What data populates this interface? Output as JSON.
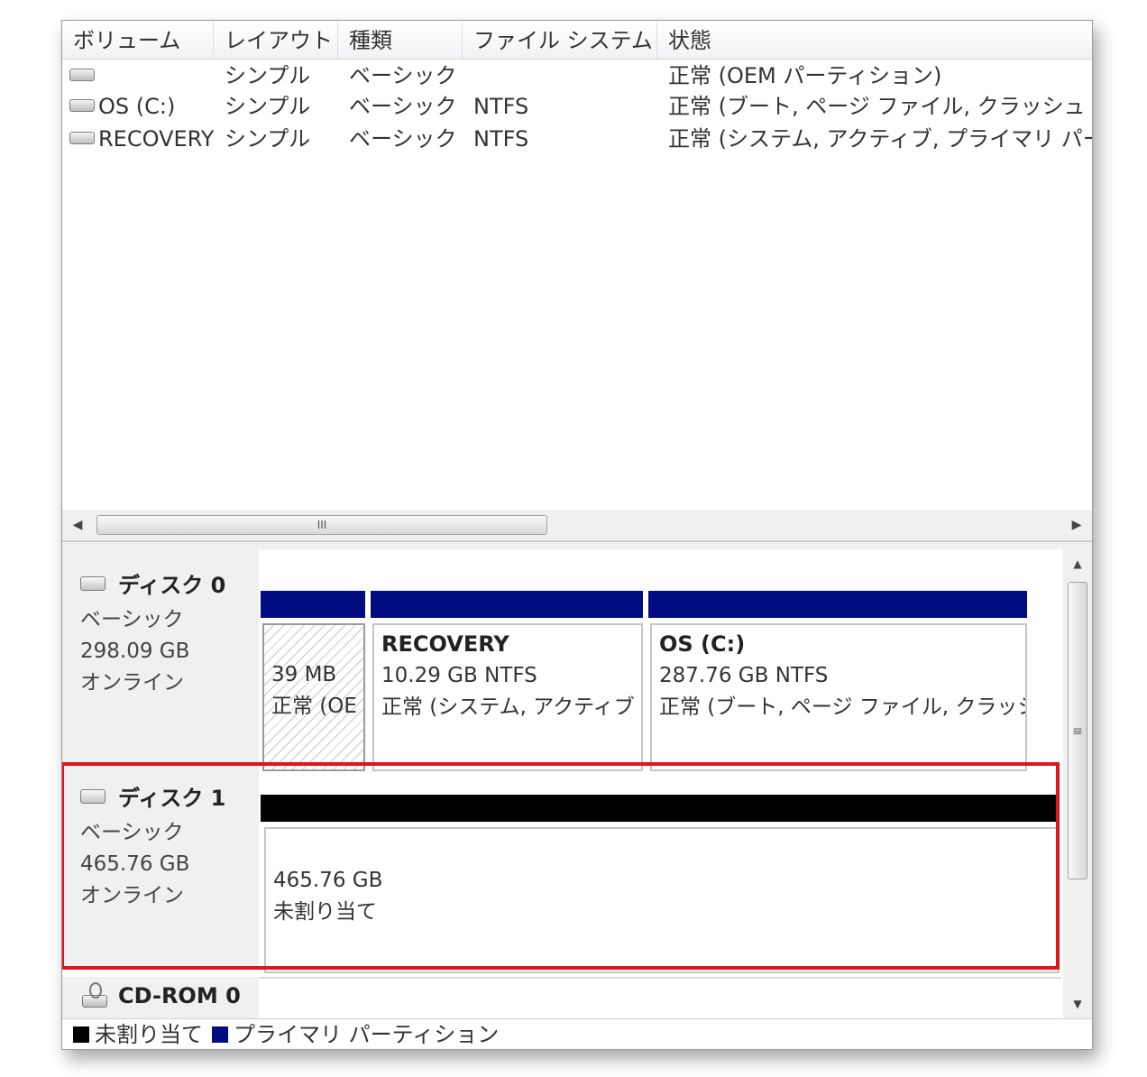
{
  "colors": {
    "unallocated": "#000000",
    "primary_partition": "#000c80",
    "highlight": "#e0141b"
  },
  "list": {
    "columns": [
      "ボリューム",
      "レイアウト",
      "種類",
      "ファイル システム",
      "状態"
    ],
    "rows": [
      {
        "volume": "",
        "layout": "シンプル",
        "type": "ベーシック",
        "fs": "",
        "status": "正常 (OEM パーティション)"
      },
      {
        "volume": "OS (C:)",
        "layout": "シンプル",
        "type": "ベーシック",
        "fs": "NTFS",
        "status": "正常 (ブート, ページ ファイル, クラッシュ ダ"
      },
      {
        "volume": "RECOVERY",
        "layout": "シンプル",
        "type": "ベーシック",
        "fs": "NTFS",
        "status": "正常 (システム, アクティブ, プライマリ パー"
      }
    ],
    "hscroll_grip": "III"
  },
  "disks": [
    {
      "name": "ディスク 0",
      "kind": "ベーシック",
      "size": "298.09 GB",
      "state": "オンライン",
      "partitions": [
        {
          "name": "",
          "size": "39 MB",
          "status": "正常 (OE"
        },
        {
          "name": "RECOVERY",
          "size": "10.29 GB NTFS",
          "status": "正常 (システム, アクティブ"
        },
        {
          "name": "OS  (C:)",
          "size": "287.76 GB NTFS",
          "status": "正常 (ブート, ページ ファイル, クラッシ"
        }
      ]
    },
    {
      "name": "ディスク 1",
      "kind": "ベーシック",
      "size": "465.76 GB",
      "state": "オンライン",
      "partitions": [
        {
          "size": "465.76 GB",
          "status": "未割り当て"
        }
      ]
    },
    {
      "name": "CD-ROM 0"
    }
  ],
  "vscroll_grip": "≡",
  "legend": [
    "未割り当て",
    "プライマリ パーティション"
  ]
}
